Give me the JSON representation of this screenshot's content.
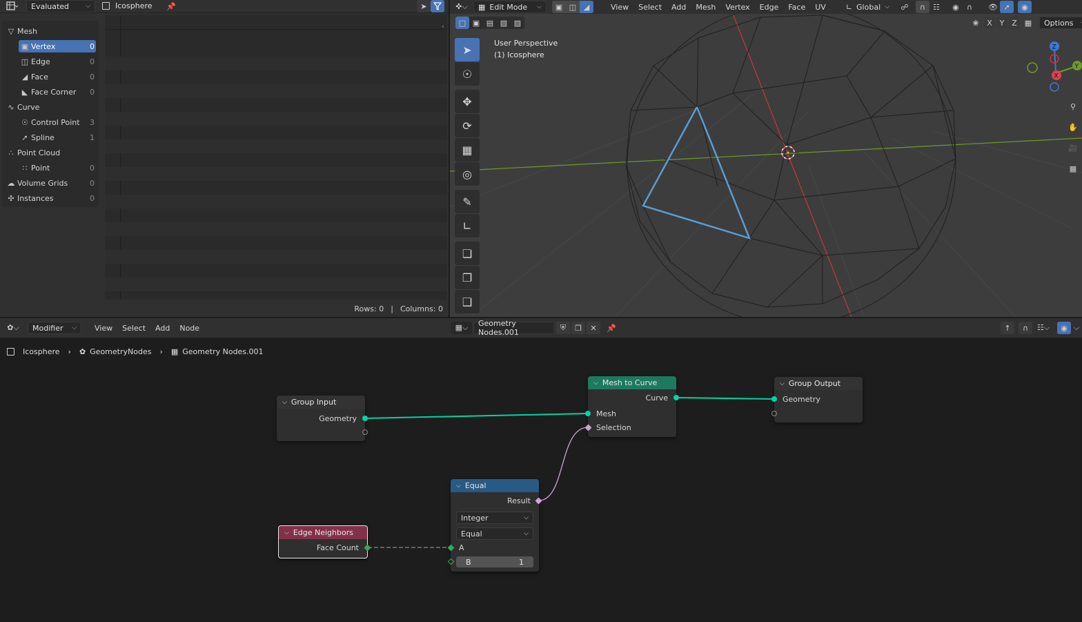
{
  "spreadsheet": {
    "header": {
      "editor_type_icon": "spreadsheet-icon",
      "display_mode": "Evaluated",
      "object_name": "Icosphere",
      "pin_icon": "pin-icon"
    },
    "sidebar": {
      "items": [
        {
          "label": "Mesh",
          "icon": "mesh-icon",
          "count": ""
        },
        {
          "label": "Vertex",
          "icon": "vertex-icon",
          "count": "0"
        },
        {
          "label": "Edge",
          "icon": "edge-icon",
          "count": "0"
        },
        {
          "label": "Face",
          "icon": "face-icon",
          "count": "0"
        },
        {
          "label": "Face Corner",
          "icon": "face-corner-icon",
          "count": "0"
        },
        {
          "label": "Curve",
          "icon": "curve-icon",
          "count": ""
        },
        {
          "label": "Control Point",
          "icon": "control-point-icon",
          "count": "3"
        },
        {
          "label": "Spline",
          "icon": "spline-icon",
          "count": "1"
        },
        {
          "label": "Point Cloud",
          "icon": "point-cloud-icon",
          "count": ""
        },
        {
          "label": "Point",
          "icon": "point-icon",
          "count": "0"
        },
        {
          "label": "Volume Grids",
          "icon": "volume-icon",
          "count": "0"
        },
        {
          "label": "Instances",
          "icon": "instances-icon",
          "count": "0"
        }
      ]
    },
    "footer": {
      "rows": "Rows: 0",
      "separator": "|",
      "columns": "Columns: 0"
    }
  },
  "viewport": {
    "header": {
      "mode": "Edit Mode",
      "menus": [
        "View",
        "Select",
        "Add",
        "Mesh",
        "Vertex",
        "Edge",
        "Face",
        "UV"
      ],
      "transform_orientation": "Global",
      "options": "Options"
    },
    "axes_toggle": [
      "X",
      "Y",
      "Z"
    ],
    "overlay_text": {
      "line1": "User Perspective",
      "line2": "(1) Icosphere"
    },
    "gizmo": {
      "x": "X",
      "y": "Y",
      "z": "Z"
    },
    "colors": {
      "selected_edge": "#5a9fd6",
      "x_axis": "#c9363f",
      "y_axis": "#6f9a2c"
    }
  },
  "node_editor": {
    "header": {
      "type": "Modifier",
      "menus": [
        "View",
        "Select",
        "Add",
        "Node"
      ],
      "node_group": "Geometry Nodes.001"
    },
    "breadcrumbs": [
      "Icosphere",
      "GeometryNodes",
      "Geometry Nodes.001"
    ],
    "nodes": {
      "group_input": {
        "title": "Group Input",
        "output": "Geometry"
      },
      "mesh_to_curve": {
        "title": "Mesh to Curve",
        "output": "Curve",
        "inputs": [
          "Mesh",
          "Selection"
        ],
        "color": "#1e7a5e"
      },
      "group_output": {
        "title": "Group Output",
        "input": "Geometry"
      },
      "equal": {
        "title": "Equal",
        "output": "Result",
        "data_type": "Integer",
        "operation": "Equal",
        "input_a": "A",
        "input_b_label": "B",
        "input_b_value": "1",
        "color": "#275a84"
      },
      "edge_neighbors": {
        "title": "Edge Neighbors",
        "output": "Face Count",
        "color": "#83314a"
      }
    }
  }
}
